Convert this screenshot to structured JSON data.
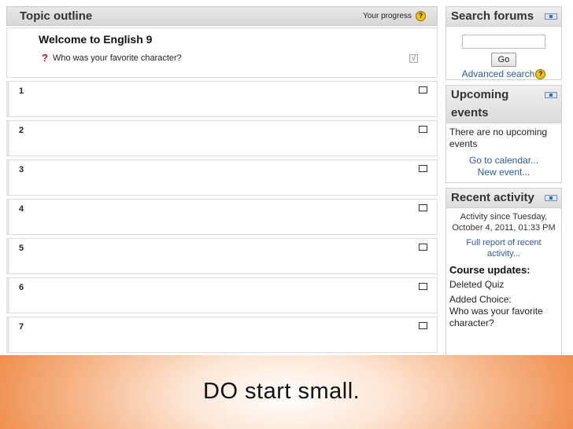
{
  "outline": {
    "title": "Topic outline",
    "progress_label": "Your progress",
    "help_symbol": "?",
    "section0": {
      "title": "Welcome to English 9",
      "activity_icon": "?",
      "activity_label": "Who was your favorite character?",
      "check_symbol": "√"
    },
    "sections": [
      "1",
      "2",
      "3",
      "4",
      "5",
      "6",
      "7"
    ]
  },
  "search": {
    "title": "Search forums",
    "go_label": "Go",
    "advanced_label": "Advanced search",
    "help_symbol": "?"
  },
  "events": {
    "title_line1": "Upcoming",
    "title_line2": "events",
    "none_line1": "There are no upcoming",
    "none_line2": "events",
    "calendar_link": "Go to calendar...",
    "new_event_link": "New event..."
  },
  "recent": {
    "title": "Recent activity",
    "since_line1": "Activity since Tuesday,",
    "since_line2": "October 4, 2011, 01:33 PM",
    "report_line1": "Full report of recent",
    "report_line2": "activity...",
    "updates_heading": "Course updates:",
    "item1": "Deleted Quiz",
    "item2_line1": "Added Choice:",
    "item2_line2": "Who was your favorite",
    "item2_line3": "character?"
  },
  "banner": {
    "text": "DO start small."
  },
  "colors": {
    "link": "#2d5a9e",
    "banner_edge": "#ef8f4f",
    "help_icon": "#f2c30d"
  }
}
